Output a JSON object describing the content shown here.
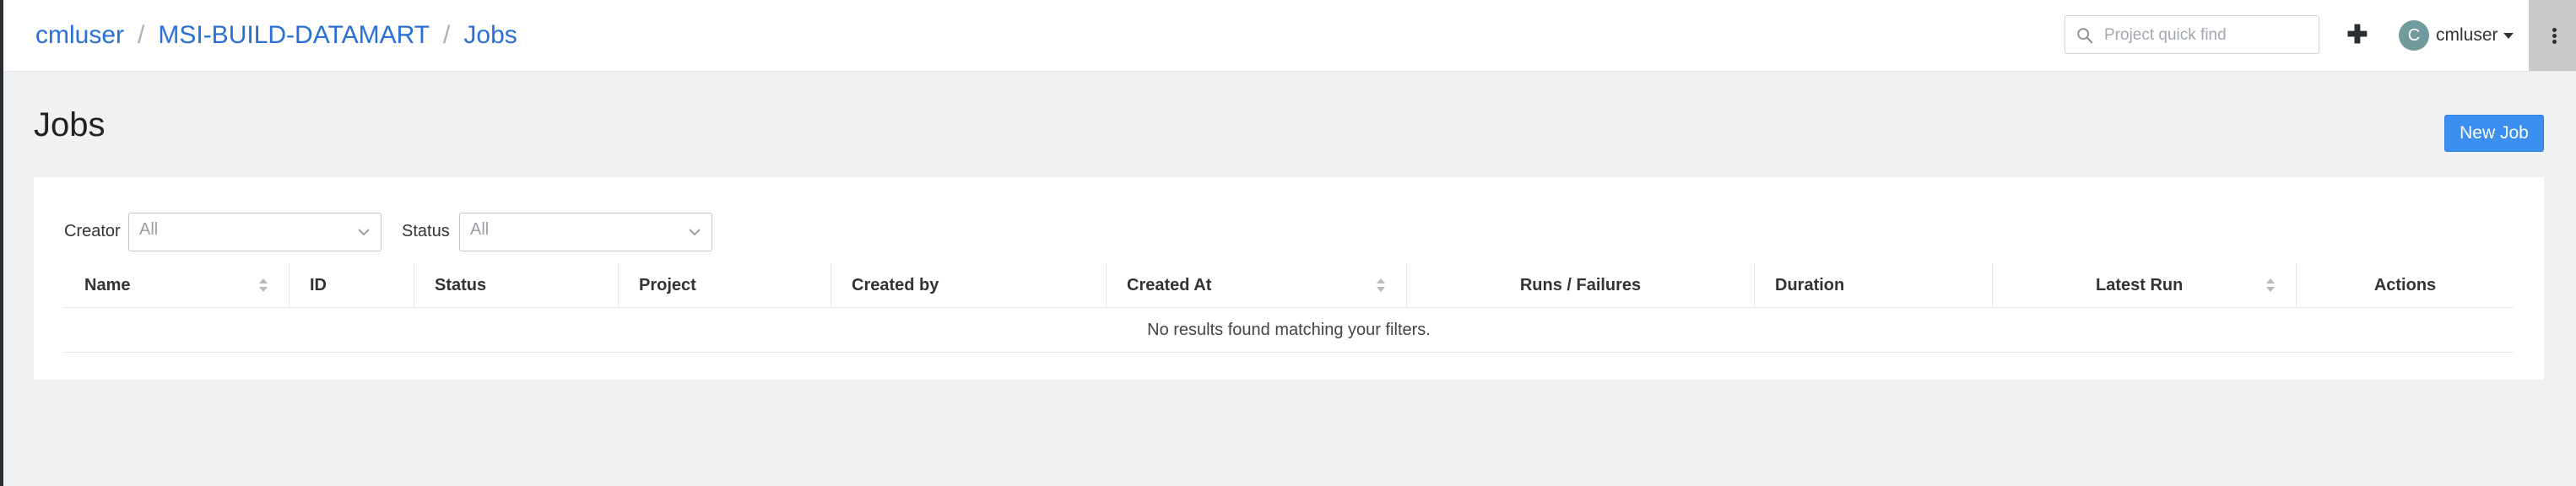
{
  "header": {
    "breadcrumb": [
      {
        "label": "cmluser"
      },
      {
        "label": "MSI-BUILD-DATAMART"
      },
      {
        "label": "Jobs"
      }
    ],
    "breadcrumb_separator": "/",
    "search": {
      "placeholder": "Project quick find",
      "value": ""
    },
    "plus_label": "✚",
    "user": {
      "initial": "C",
      "name": "cmluser"
    }
  },
  "page": {
    "title": "Jobs",
    "new_job_label": "New Job"
  },
  "filters": {
    "creator": {
      "label": "Creator",
      "value": "All"
    },
    "status": {
      "label": "Status",
      "value": "All"
    }
  },
  "table": {
    "columns": [
      {
        "label": "Name",
        "sortable": true
      },
      {
        "label": "ID",
        "sortable": false
      },
      {
        "label": "Status",
        "sortable": false
      },
      {
        "label": "Project",
        "sortable": false
      },
      {
        "label": "Created by",
        "sortable": false
      },
      {
        "label": "Created At",
        "sortable": true
      },
      {
        "label": "Runs / Failures",
        "sortable": false
      },
      {
        "label": "Duration",
        "sortable": false
      },
      {
        "label": "Latest Run",
        "sortable": true
      },
      {
        "label": "Actions",
        "sortable": false
      }
    ],
    "rows": [],
    "empty_message": "No results found matching your filters."
  },
  "colors": {
    "link": "#2a6fd6",
    "primary_button": "#3b8ff0",
    "avatar": "#6f9b9c",
    "background": "#f0f1f2"
  },
  "icons": [
    "search-icon",
    "plus-icon",
    "caret-down-icon",
    "kebab-menu-icon",
    "chevron-down-icon",
    "sort-icon"
  ]
}
